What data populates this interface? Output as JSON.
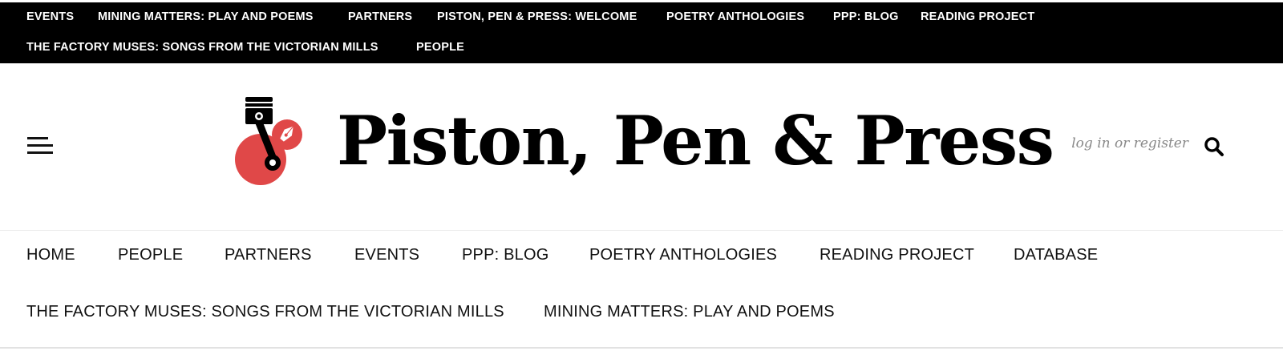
{
  "top_menu": {
    "items": [
      {
        "label": "EVENTS"
      },
      {
        "label": "MINING MATTERS: PLAY AND POEMS"
      },
      {
        "label": "PARTNERS"
      },
      {
        "label": "PISTON, PEN & PRESS: WELCOME"
      },
      {
        "label": "POETRY ANTHOLOGIES"
      },
      {
        "label": "PPP: BLOG"
      },
      {
        "label": "READING PROJECT"
      },
      {
        "label": "THE FACTORY MUSES: SONGS FROM THE VICTORIAN MILLS"
      },
      {
        "label": "PEOPLE"
      }
    ]
  },
  "header": {
    "site_title": "Piston, Pen & Press",
    "login_label": "log in or register",
    "logo_icon": "piston-pen-logo-icon",
    "menu_icon": "hamburger-menu-icon",
    "search_icon": "search-icon",
    "colors": {
      "logo_accent": "#e04848",
      "topbar_bg": "#000000",
      "login_text": "#888888"
    }
  },
  "main_menu": {
    "items": [
      {
        "label": "HOME"
      },
      {
        "label": "PEOPLE"
      },
      {
        "label": "PARTNERS"
      },
      {
        "label": "EVENTS"
      },
      {
        "label": "PPP: BLOG"
      },
      {
        "label": "POETRY ANTHOLOGIES"
      },
      {
        "label": "READING PROJECT"
      },
      {
        "label": "DATABASE"
      },
      {
        "label": "THE FACTORY MUSES: SONGS FROM THE VICTORIAN MILLS"
      },
      {
        "label": "MINING MATTERS: PLAY AND POEMS"
      }
    ]
  }
}
